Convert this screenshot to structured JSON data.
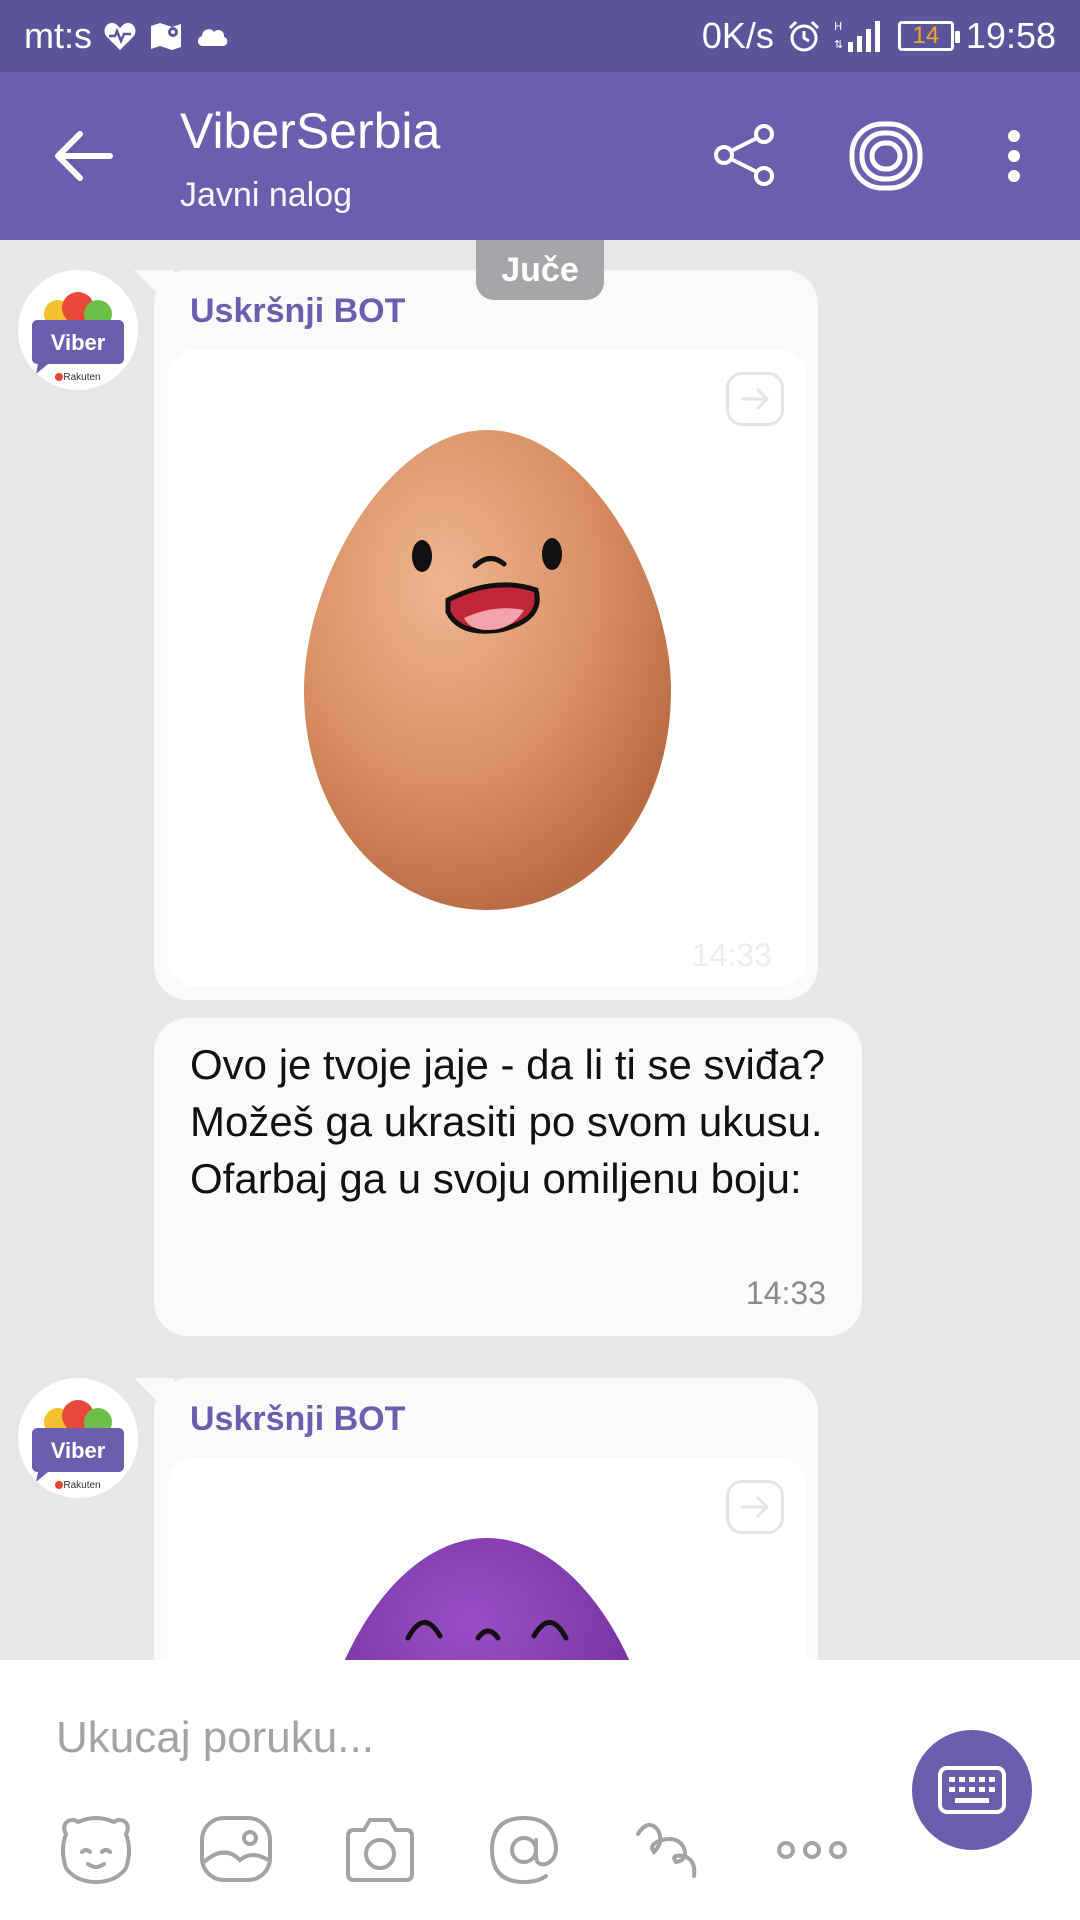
{
  "status_bar": {
    "carrier": "mt:s",
    "net_speed": "0K/s",
    "battery": "14",
    "time": "19:58"
  },
  "header": {
    "title": "ViberSerbia",
    "subtitle": "Javni nalog"
  },
  "chat": {
    "date_label": "Juče",
    "messages": [
      {
        "sender": "Uskršnji BOT",
        "time": "14:33",
        "image": "smiling brown egg"
      },
      {
        "text": "Ovo je tvoje jaje - da li ti se sviđa? Možeš ga ukrasiti po svom ukusu. Ofarbaj ga u svoju omiljenu boju:",
        "time": "14:33"
      },
      {
        "sender": "Uskršnji BOT",
        "image": "smiling purple egg"
      }
    ]
  },
  "composer": {
    "placeholder": "Ukucaj poruku..."
  },
  "avatar": {
    "brand": "Viber",
    "sub": "Rakuten"
  },
  "colors": {
    "status_bar": "#5a559a",
    "accent": "#6a5faf",
    "chat_background": "#e7e7ea",
    "bubble": "#fafafa",
    "timestamp": "#8a8a8e",
    "battery_text": "#f5a623"
  },
  "icons": [
    "heart-pulse-icon",
    "map-icon",
    "cloud-icon",
    "alarm-icon",
    "signal-icon",
    "battery-icon",
    "back-arrow-icon",
    "share-icon",
    "concentric-rings-icon",
    "more-vert-icon",
    "forward-icon",
    "sticker-icon",
    "gallery-icon",
    "camera-icon",
    "at-icon",
    "doodle-icon",
    "more-horiz-icon",
    "keyboard-icon"
  ]
}
